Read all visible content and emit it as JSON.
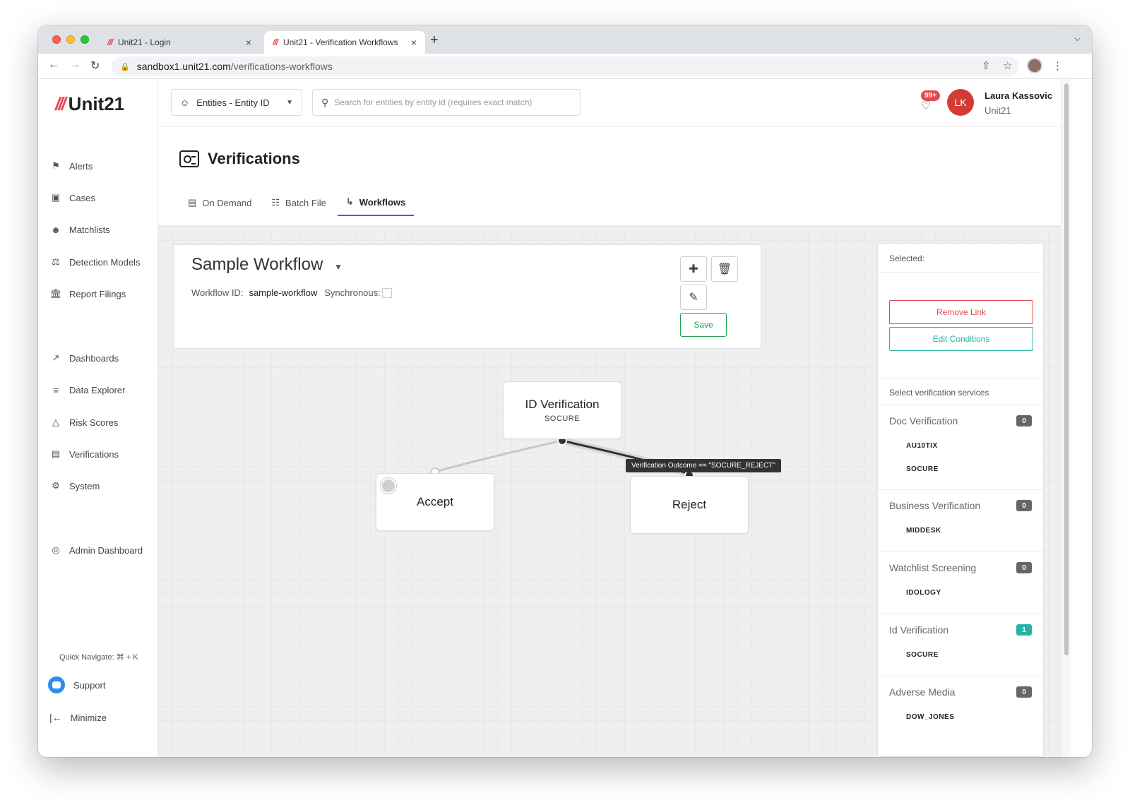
{
  "browser": {
    "tabs": [
      {
        "title": "Unit21 - Login",
        "favicon": "///",
        "close": "×"
      },
      {
        "title": "Unit21 - Verification Workflows",
        "favicon": "///",
        "close": "×"
      }
    ],
    "new_tab": "+",
    "url_host": "sandbox1.unit21.com",
    "url_path": "/verifications-workflows"
  },
  "sidebar": {
    "logo": "Unit21",
    "logo_mark": "///",
    "items": [
      {
        "label": "Alerts",
        "icon": "flag-icon"
      },
      {
        "label": "Cases",
        "icon": "briefcase-icon"
      },
      {
        "label": "Matchlists",
        "icon": "user-check-icon"
      },
      {
        "label": "Detection Models",
        "icon": "scale-icon"
      },
      {
        "label": "Report Filings",
        "icon": "bank-icon"
      },
      {
        "label": "Dashboards",
        "icon": "chart-line-icon"
      },
      {
        "label": "Data Explorer",
        "icon": "data-search-icon"
      },
      {
        "label": "Risk Scores",
        "icon": "warning-icon"
      },
      {
        "label": "Verifications",
        "icon": "id-card-icon"
      },
      {
        "label": "System",
        "icon": "gear-icon"
      },
      {
        "label": "Admin Dashboard",
        "icon": "globe-icon"
      }
    ],
    "quick_navigate": "Quick Navigate: ⌘ + K",
    "support": "Support",
    "minimize": "Minimize"
  },
  "topbar": {
    "entity_select": "Entities - Entity ID",
    "search_placeholder": "Search for entities by entity id (requires exact match)",
    "notifications": "99+",
    "user_initials": "LK",
    "user_name": "Laura Kassovic",
    "user_org": "Unit21"
  },
  "page": {
    "title": "Verifications",
    "tabs": [
      {
        "label": "On Demand",
        "active": false
      },
      {
        "label": "Batch File",
        "active": false
      },
      {
        "label": "Workflows",
        "active": true
      }
    ]
  },
  "workflow": {
    "name": "Sample Workflow",
    "id_label": "Workflow ID:",
    "id_value": "sample-workflow",
    "sync_label": "Synchronous:",
    "save": "Save",
    "nodes": {
      "root_title": "ID Verification",
      "root_sub": "SOCURE",
      "accept": "Accept",
      "reject": "Reject"
    },
    "edge_label": "Verification Outcome == \"SOCURE_REJECT\""
  },
  "panel": {
    "selected_label": "Selected:",
    "remove_link": "Remove Link",
    "edit_conditions": "Edit Conditions",
    "services_title": "Select verification services",
    "services": [
      {
        "name": "Doc Verification",
        "count": "0",
        "providers": [
          "AU10TIX",
          "SOCURE"
        ]
      },
      {
        "name": "Business Verification",
        "count": "0",
        "providers": [
          "MIDDESK"
        ]
      },
      {
        "name": "Watchlist Screening",
        "count": "0",
        "providers": [
          "IDOLOGY"
        ]
      },
      {
        "name": "Id Verification",
        "count": "1",
        "providers": [
          "SOCURE"
        ]
      },
      {
        "name": "Adverse Media",
        "count": "0",
        "providers": [
          "DOW_JONES"
        ]
      }
    ]
  },
  "colors": {
    "accent": "#2b6fd6",
    "danger": "#e5484d",
    "success": "#21a34a",
    "teal": "#22b5a6"
  }
}
